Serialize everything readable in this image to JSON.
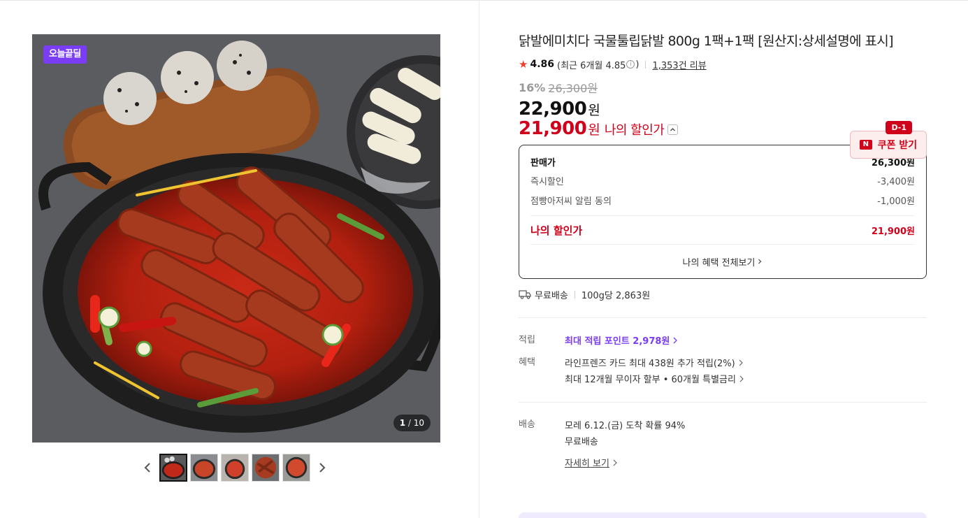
{
  "gallery": {
    "badge": "오늘끝딜",
    "counter_current": "1",
    "counter_total": "10",
    "counter_sep": " / ",
    "thumbnail_count": 5,
    "active_thumbnail": 1
  },
  "product": {
    "title": "닭발에미치다 국물툴립닭발 800g 1팩+1팩 [원산지:상세설명에 표시]",
    "rating": "4.86",
    "rating_recent": "(최근 6개월 4.85",
    "rating_recent_close": ")",
    "review_count": "1,353건 리뷰",
    "discount_rate": "16%",
    "original_price": "26,300원",
    "sale_price": "22,900",
    "won": "원",
    "my_price": "21,900",
    "my_price_won": "원",
    "my_price_label": "나의 할인가"
  },
  "coupon": {
    "label": "쿠폰 받기",
    "logo": "N",
    "d_day": "D-1"
  },
  "price_breakdown": {
    "sale_label": "판매가",
    "sale_value": "26,300원",
    "instant_label": "즉시할인",
    "instant_value": "-3,400원",
    "alarm_label": "점빵아저씨 알림 동의",
    "alarm_value": "-1,000원",
    "mine_label": "나의 할인가",
    "mine_value": "21,900원",
    "more_label": "나의 혜택 전체보기"
  },
  "shipping_summary": {
    "free": "무료배송",
    "unit_price": "100g당 2,863원"
  },
  "points": {
    "label": "적립",
    "value": "최대 적립 포인트 2,978원"
  },
  "benefits": {
    "label": "혜택",
    "card": "라인프렌즈 카드 최대 438원 추가 적립(2%)",
    "installment": "최대 12개월 무이자 할부 • 60개월 특별금리"
  },
  "delivery": {
    "label": "배송",
    "eta": "모레 6.12.(금) 도착 확률 94%",
    "fee": "무료배송",
    "more": "자세히 보기"
  },
  "colors": {
    "accent_red": "#d0021b",
    "accent_purple": "#7b3cf5",
    "star": "#f03c2b"
  }
}
